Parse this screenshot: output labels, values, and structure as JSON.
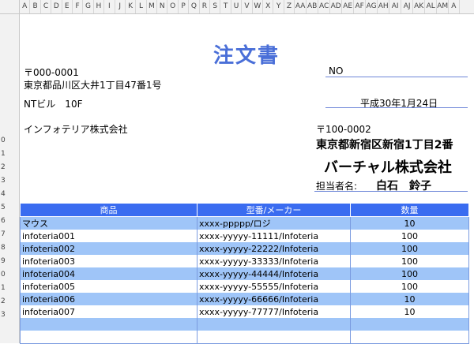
{
  "columns": [
    "A",
    "B",
    "C",
    "D",
    "E",
    "F",
    "G",
    "H",
    "I",
    "J",
    "K",
    "L",
    "M",
    "N",
    "O",
    "P",
    "Q",
    "R",
    "S",
    "T",
    "U",
    "V",
    "W",
    "X",
    "Y",
    "Z",
    "AA",
    "AB",
    "AC",
    "AD",
    "AE",
    "AF",
    "AG",
    "AH",
    "AI",
    "AJ",
    "AK",
    "AL",
    "AM",
    "A"
  ],
  "rows": [
    "",
    "",
    "",
    "",
    "",
    "",
    "",
    "",
    "",
    "0",
    "1",
    "2",
    "3",
    "4",
    "5",
    "6",
    "7",
    "8",
    "9",
    "0",
    "1",
    "2",
    "3",
    ""
  ],
  "doc": {
    "title": "注文書",
    "from_postal": "〒000-0001",
    "from_address": "東京都品川区大井1丁目47番1号",
    "from_building": "NTビル　10F",
    "from_company": "インフォテリア株式会社",
    "no_label": "NO",
    "date": "平成30年1月24日",
    "to_postal": "〒100-0002",
    "to_address": "東京都新宿区新宿1丁目2番",
    "to_company": "バーチャル株式会社",
    "person_label": "担当者名:",
    "person_name": "白石　鈴子"
  },
  "table": {
    "headers": [
      "商品",
      "型番/メーカー",
      "数量"
    ],
    "rows": [
      [
        "マウス",
        "xxxx-ppppp/ロジ",
        "10"
      ],
      [
        "infoteria001",
        "xxxx-yyyyy-11111/Infoteria",
        "100"
      ],
      [
        "infoteria002",
        "xxxx-yyyyy-22222/Infoteria",
        "100"
      ],
      [
        "infoteria003",
        "xxxx-yyyyy-33333/Infoteria",
        "100"
      ],
      [
        "infoteria004",
        "xxxx-yyyyy-44444/Infoteria",
        "100"
      ],
      [
        "infoteria005",
        "xxxx-yyyyy-55555/Infoteria",
        "100"
      ],
      [
        "infoteria006",
        "xxxx-yyyyy-66666/Infoteria",
        "10"
      ],
      [
        "infoteria007",
        "xxxx-yyyyy-77777/Infoteria",
        "10"
      ],
      [
        "",
        "",
        ""
      ],
      [
        "",
        "",
        ""
      ]
    ]
  }
}
